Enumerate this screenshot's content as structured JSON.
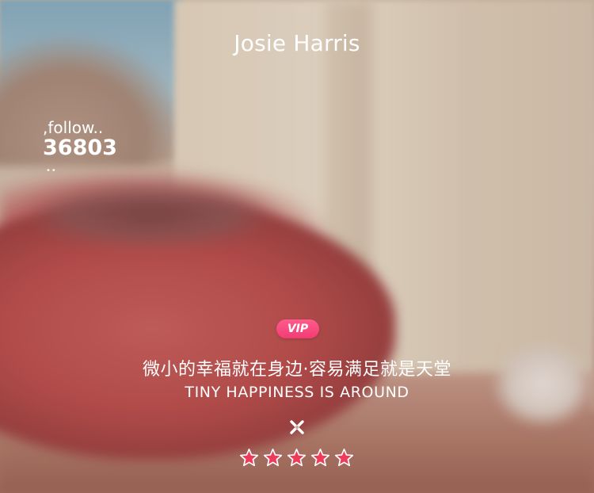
{
  "profile": {
    "name": "Josie Harris",
    "follow_label": ",follow..",
    "follow_count": "36803",
    "dots": "••"
  },
  "badge": {
    "label": "VIP",
    "color": "#f23c74"
  },
  "quote": {
    "chinese": "微小的幸福就在身边·容易满足就是天堂",
    "english": "TINY HAPPINESS IS AROUND"
  },
  "close_icon": "close-x-icon",
  "rating": {
    "value": 5,
    "max": 5,
    "star_color": "#f03a5a",
    "star_icon": "star-icon"
  }
}
